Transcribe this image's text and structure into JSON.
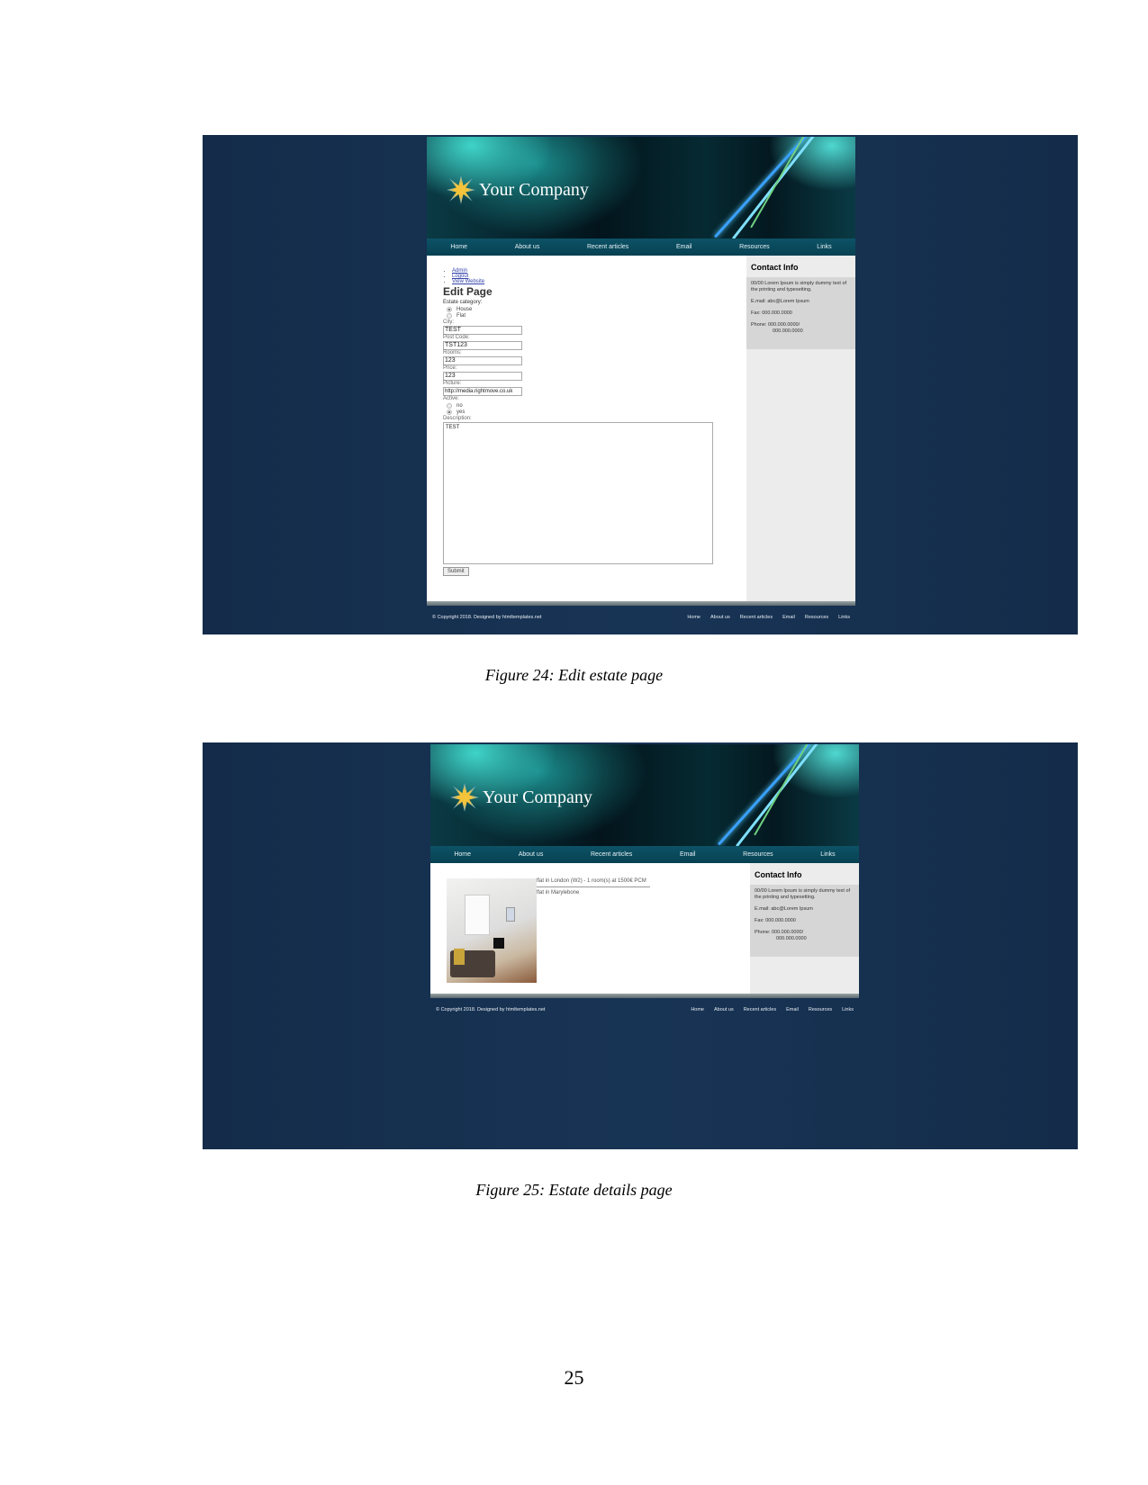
{
  "site": {
    "company": "Your Company",
    "nav": [
      "Home",
      "About us",
      "Recent articles",
      "Email",
      "Resources",
      "Links"
    ],
    "copyright": "© Copyright 2018. Designed by htmltemplates.net",
    "contact": {
      "title": "Contact Info",
      "text": "00/00 Lorem Ipsum is simply dummy text of the printing and typesetting.",
      "email": "E.mail: abc@Lorem Ipsum",
      "fax": "Fax: 000.000.0000",
      "phone": "Phone: 000.000.0000/",
      "phone2": "000.000.0000"
    }
  },
  "edit_page": {
    "links": [
      "Admin",
      "Logout",
      "View Website"
    ],
    "title": "Edit Page",
    "category_label": "Estate category:",
    "category_options": [
      "House",
      "Flat"
    ],
    "category_selected": "House",
    "city_label": "City:",
    "city": "TEST",
    "postcode_label": "Post Code:",
    "postcode": "TST123",
    "rooms_label": "Rooms:",
    "rooms": "123",
    "price_label": "Price:",
    "price": "123",
    "picture_label": "Picture:",
    "picture": "http://media.rightmove.co.uk",
    "active_label": "Active:",
    "active_options": [
      "no",
      "yes"
    ],
    "active_selected": "yes",
    "description_label": "Description:",
    "description": "TEST",
    "submit": "Submit"
  },
  "details_page": {
    "listing_title": "flat in London (W2) - 1 room(s) at 1500€ PCM",
    "listing_desc": "flat in Marylebone"
  },
  "captions": {
    "fig24": "Figure 24: Edit estate page",
    "fig25": "Figure 25: Estate details page"
  },
  "page_number": "25"
}
